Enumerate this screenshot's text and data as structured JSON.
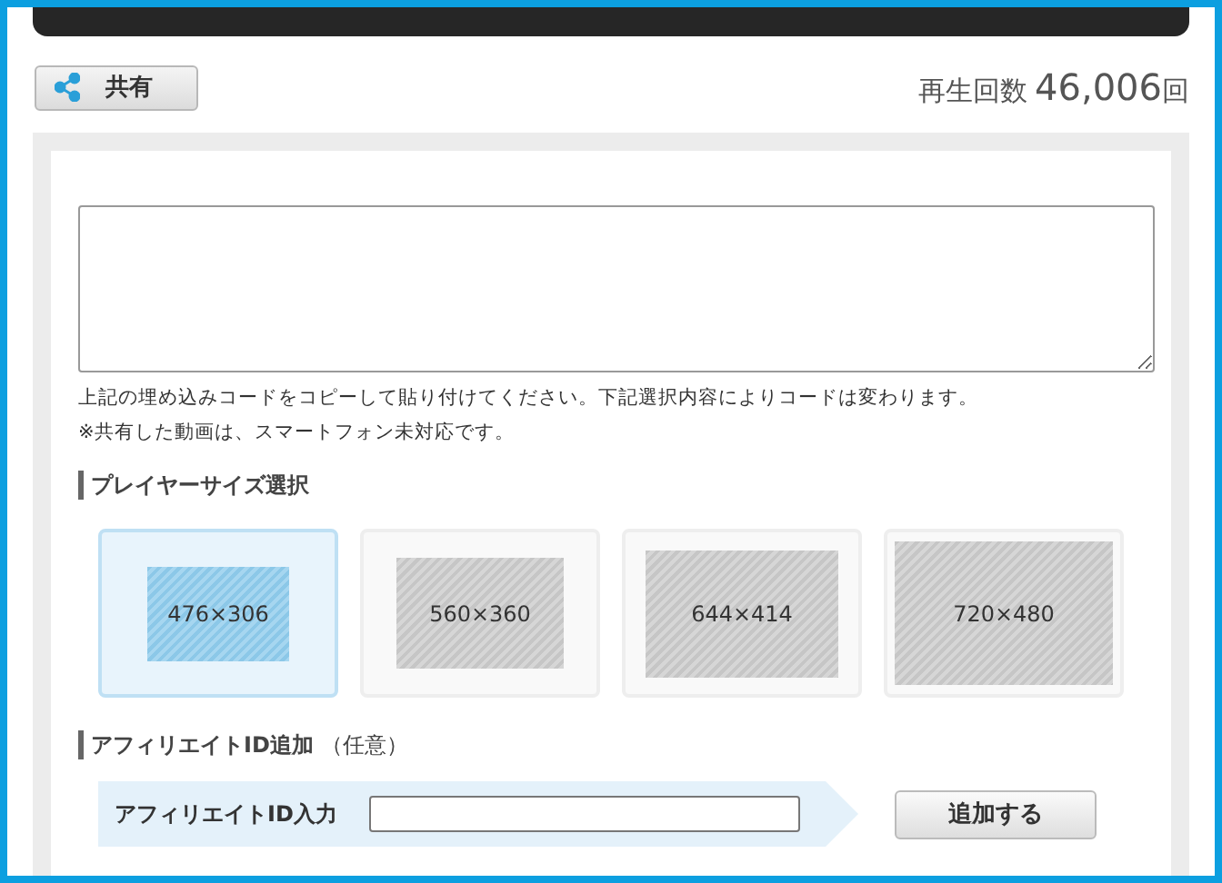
{
  "share_button": {
    "label": "共有"
  },
  "play_count": {
    "label": "再生回数",
    "value": "46,006",
    "unit": "回"
  },
  "embed": {
    "notes": [
      "上記の埋め込みコードをコピーして貼り付けてください。下記選択内容によりコードは変わります。",
      "※共有した動画は、スマートフォン未対応です。"
    ]
  },
  "player_size": {
    "heading": "プレイヤーサイズ選択",
    "options": [
      {
        "label": "476×306",
        "selected": true
      },
      {
        "label": "560×360",
        "selected": false
      },
      {
        "label": "644×414",
        "selected": false
      },
      {
        "label": "720×480",
        "selected": false
      }
    ]
  },
  "affiliate": {
    "heading": "アフィリエイトID追加",
    "note": "（任意）",
    "input_label": "アフィリエイトID入力",
    "button": "追加する"
  }
}
